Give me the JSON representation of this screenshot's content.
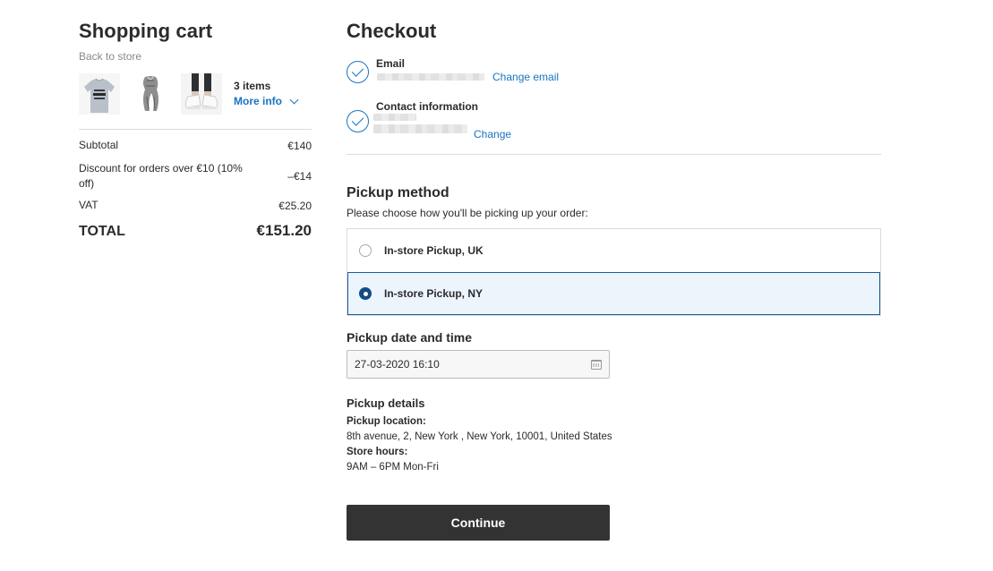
{
  "cart": {
    "title": "Shopping cart",
    "back_link": "Back to store",
    "items_count": "3 items",
    "more_info": "More info",
    "products": [
      {
        "icon": "tshirt-product-image"
      },
      {
        "icon": "scarf-product-image"
      },
      {
        "icon": "sneakers-product-image"
      }
    ],
    "summary": {
      "subtotal_label": "Subtotal",
      "subtotal_value": "€140",
      "discount_label": "Discount for orders over €10 (10% off)",
      "discount_value": "–€14",
      "vat_label": "VAT",
      "vat_value": "€25.20",
      "total_label": "TOTAL",
      "total_value": "€151.20"
    }
  },
  "checkout": {
    "title": "Checkout",
    "email": {
      "label": "Email",
      "change_link": "Change email"
    },
    "contact": {
      "label": "Contact information",
      "change_link": "Change"
    },
    "pickup": {
      "title": "Pickup method",
      "subtitle": "Please choose how you'll be picking up your order:",
      "options": [
        {
          "label": "In-store Pickup, UK",
          "selected": false
        },
        {
          "label": "In-store Pickup, NY",
          "selected": true
        }
      ]
    },
    "datetime": {
      "title": "Pickup date and time",
      "value": "27-03-2020 16:10",
      "icon": "calendar-icon"
    },
    "details": {
      "title": "Pickup details",
      "location_label": "Pickup location:",
      "location_value": "8th avenue, 2, New York , New York, 10001, United States",
      "hours_label": "Store hours:",
      "hours_value": "9AM – 6PM Mon-Fri"
    },
    "continue_label": "Continue"
  },
  "colors": {
    "accent": "#1a73c1",
    "selected_bg": "#ecf4fc",
    "button_bg": "#333333"
  }
}
